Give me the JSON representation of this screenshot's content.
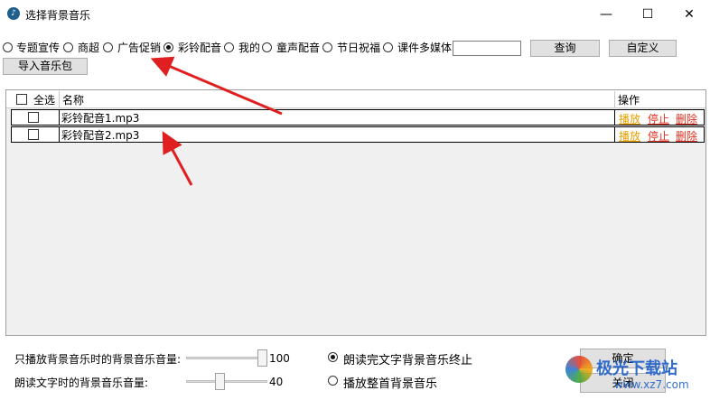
{
  "window": {
    "title": "选择背景音乐",
    "minimize_glyph": "—",
    "maximize_glyph": "☐",
    "close_glyph": "✕"
  },
  "categories": [
    {
      "label": "专题宣传",
      "checked": false
    },
    {
      "label": "商超",
      "checked": false
    },
    {
      "label": "广告促销",
      "checked": false
    },
    {
      "label": "彩铃配音",
      "checked": true
    },
    {
      "label": "我的",
      "checked": false
    },
    {
      "label": "童声配音",
      "checked": false
    },
    {
      "label": "节日祝福",
      "checked": false
    },
    {
      "label": "课件多媒体",
      "checked": false
    }
  ],
  "search": {
    "value": ""
  },
  "buttons": {
    "query": "查询",
    "custom": "自定义",
    "import": "导入音乐包",
    "ok": "确定",
    "close": "关闭"
  },
  "table": {
    "select_all": "全选",
    "col_name": "名称",
    "col_ops": "操作",
    "rows": [
      {
        "name": "彩铃配音1.mp3",
        "play": "播放",
        "stop": "停止",
        "delete": "删除"
      },
      {
        "name": "彩铃配音2.mp3",
        "play": "播放",
        "stop": "停止",
        "delete": "删除"
      }
    ]
  },
  "volume": {
    "bg_label": "只播放背景音乐时的背景音乐音量:",
    "bg_value": "100",
    "bg_level": 1.0,
    "read_label": "朗读文字时的背景音乐音量:",
    "read_value": "40",
    "read_level": 0.4
  },
  "playback": {
    "option1": "朗读完文字背景音乐终止",
    "option2": "播放整首背景音乐",
    "selected": 1
  },
  "watermark": {
    "text": "极光下载站",
    "url": "www.xz7.com"
  },
  "colors": {
    "annotation_arrow": "#e02020",
    "op_play": "#e8a000",
    "op_stop": "#e03020"
  }
}
